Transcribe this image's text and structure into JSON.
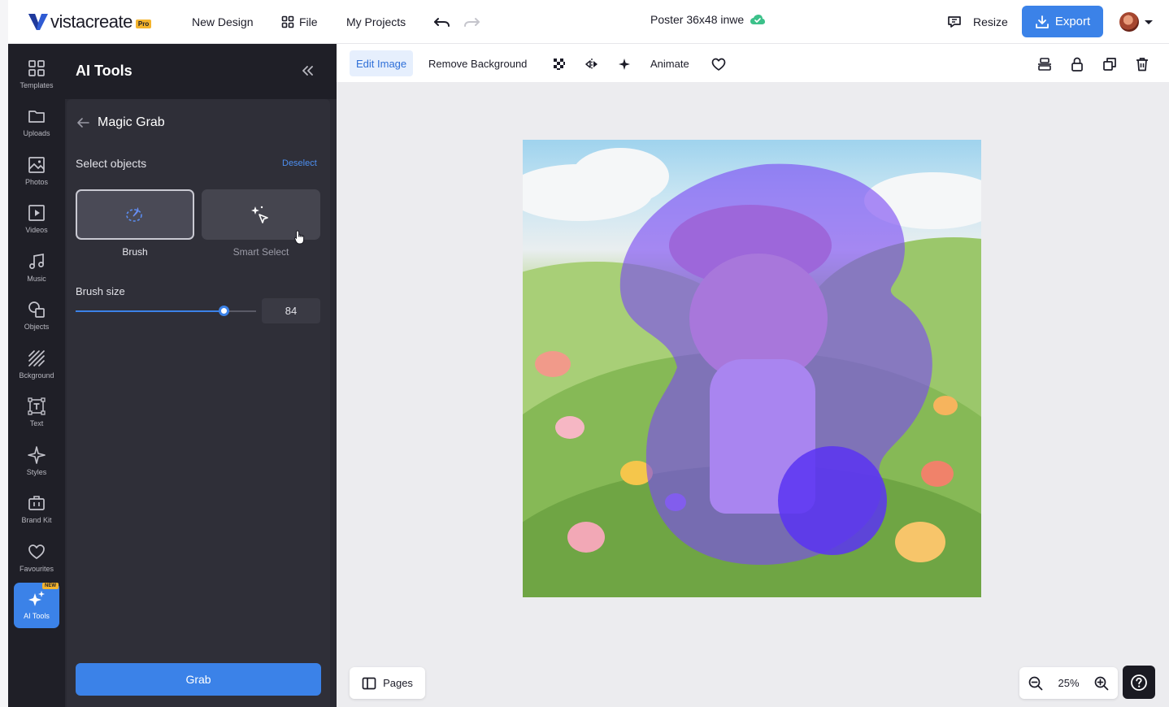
{
  "brand": {
    "logo_text": "vistacreate",
    "pro_badge": "Pro",
    "accent": "#3b82e8"
  },
  "topbar": {
    "new_design": "New Design",
    "file": "File",
    "my_projects": "My Projects",
    "doc_title": "Poster 36x48 inwe",
    "resize": "Resize",
    "export": "Export"
  },
  "rail": {
    "items": [
      {
        "label": "Templates",
        "icon": "templates-icon"
      },
      {
        "label": "Uploads",
        "icon": "folder-icon"
      },
      {
        "label": "Photos",
        "icon": "image-icon"
      },
      {
        "label": "Videos",
        "icon": "video-icon"
      },
      {
        "label": "Music",
        "icon": "music-icon"
      },
      {
        "label": "Objects",
        "icon": "shapes-icon"
      },
      {
        "label": "Bckground",
        "icon": "background-icon"
      },
      {
        "label": "Text",
        "icon": "text-icon"
      },
      {
        "label": "Styles",
        "icon": "sparkle-icon"
      },
      {
        "label": "Brand Kit",
        "icon": "briefcase-icon"
      },
      {
        "label": "Favourites",
        "icon": "heart-icon"
      }
    ],
    "ai_tools": {
      "label": "AI Tools",
      "badge": "NEW"
    }
  },
  "panel": {
    "title": "AI Tools",
    "section_title": "Magic Grab",
    "select_label": "Select objects",
    "deselect": "Deselect",
    "options": [
      {
        "label": "Brush",
        "selected": true
      },
      {
        "label": "Smart Select",
        "selected": false
      }
    ],
    "brush_size_label": "Brush size",
    "brush_size_value": "84",
    "brush_size_fraction": 0.82,
    "grab_button": "Grab"
  },
  "toolbar2": {
    "edit_image": "Edit Image",
    "remove_background": "Remove Background",
    "animate": "Animate"
  },
  "canvas": {
    "pages": "Pages",
    "zoom": "25%"
  }
}
